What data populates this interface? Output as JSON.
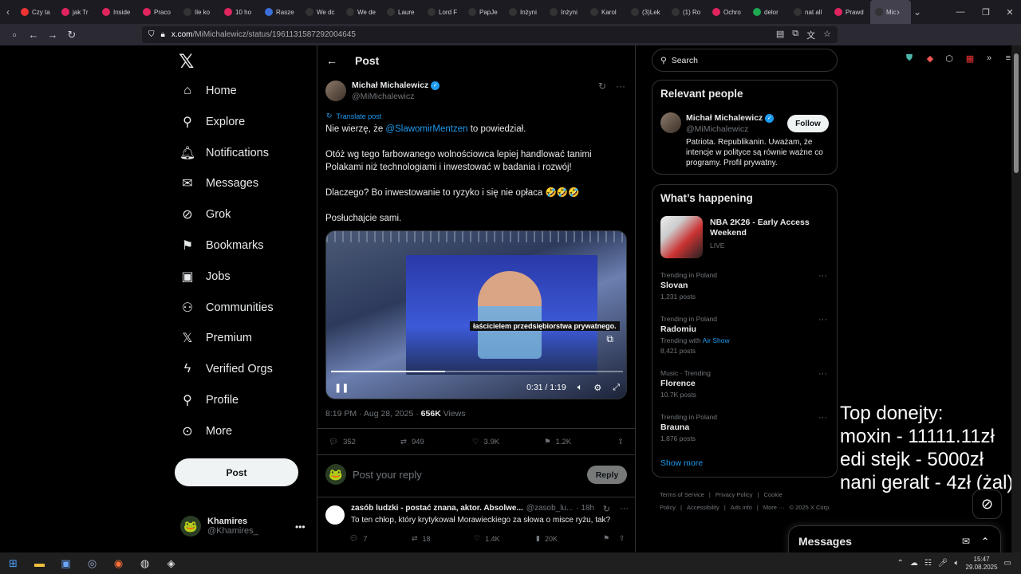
{
  "browser": {
    "tabs": [
      {
        "label": "Czy ta",
        "color": "#e33"
      },
      {
        "label": "jak Tr",
        "color": "#e0245e"
      },
      {
        "label": "Inside",
        "color": "#e0245e"
      },
      {
        "label": "Praco",
        "color": "#e0245e"
      },
      {
        "label": "Ile ko",
        "color": "#333"
      },
      {
        "label": "10 ho",
        "color": "#e0245e"
      },
      {
        "label": "Rasze",
        "color": "#3b6fd8"
      },
      {
        "label": "We dc",
        "color": "#333"
      },
      {
        "label": "We de",
        "color": "#333"
      },
      {
        "label": "Laure",
        "color": "#333"
      },
      {
        "label": "Lord F",
        "color": "#333"
      },
      {
        "label": "PapJe",
        "color": "#333"
      },
      {
        "label": "Inżyni",
        "color": "#333"
      },
      {
        "label": "Inżyni",
        "color": "#333"
      },
      {
        "label": "Karol",
        "color": "#333"
      },
      {
        "label": "(3)Lek",
        "color": "#333"
      },
      {
        "label": "(1) Ro",
        "color": "#333"
      },
      {
        "label": "Ochro",
        "color": "#e0245e"
      },
      {
        "label": "delor",
        "color": "#1da851"
      },
      {
        "label": "nat all",
        "color": "#333"
      },
      {
        "label": "Prawd",
        "color": "#e0245e"
      },
      {
        "label": "Mic",
        "color": "#333",
        "active": true
      }
    ],
    "url_host": "x.com",
    "url_path": "/MiMichalewicz/status/1961131587292004645"
  },
  "sidebar": {
    "logo": "𝕏",
    "items": [
      {
        "label": "Home",
        "icon": "home-icon",
        "glyph": "⌂"
      },
      {
        "label": "Explore",
        "icon": "search-icon",
        "glyph": "⚲"
      },
      {
        "label": "Notifications",
        "icon": "bell-icon",
        "glyph": "🔔︎"
      },
      {
        "label": "Messages",
        "icon": "envelope-icon",
        "glyph": "✉"
      },
      {
        "label": "Grok",
        "icon": "grok-icon",
        "glyph": "⊘"
      },
      {
        "label": "Bookmarks",
        "icon": "bookmark-icon",
        "glyph": "⚑"
      },
      {
        "label": "Jobs",
        "icon": "briefcase-icon",
        "glyph": "▣"
      },
      {
        "label": "Communities",
        "icon": "people-icon",
        "glyph": "⚇"
      },
      {
        "label": "Premium",
        "icon": "x-logo-icon",
        "glyph": "𝕏"
      },
      {
        "label": "Verified Orgs",
        "icon": "lightning-icon",
        "glyph": "ϟ"
      },
      {
        "label": "Profile",
        "icon": "person-icon",
        "glyph": "⚲"
      },
      {
        "label": "More",
        "icon": "more-circle-icon",
        "glyph": "⊙"
      }
    ],
    "post_label": "Post",
    "account": {
      "name": "Khamires",
      "handle": "@Khamires_"
    }
  },
  "post": {
    "header_title": "Post",
    "author_name": "Michał Michalewicz",
    "author_handle": "@MiMichalewicz",
    "translate_label": "Translate post",
    "text_p1_before": "Nie wierzę, że ",
    "text_p1_mention": "@SlawomirMentzen",
    "text_p1_after": " to powiedział.",
    "text_p2": "Otóż wg tego farbowanego wolnościowca lepiej handlować tanimi Polakami niż technologiami i inwestować w badania i rozwój!",
    "text_p3": "Dlaczego? Bo inwestowanie to ryzyko i się nie opłaca 🤣🤣🤣",
    "text_p4": "Posłuchajcie sami.",
    "video": {
      "caption": "łaścicielem przedsiębiorstwa prywatnego.",
      "time": "0:31 / 1:19",
      "progress": 0.39
    },
    "timestamp": "8:19 PM · Aug 28, 2025 · ",
    "views_count": "656K",
    "views_label": " Views",
    "stats": {
      "replies": "352",
      "reposts": "949",
      "likes": "3.9K",
      "bookmarks": "1.2K"
    },
    "reply_placeholder": "Post your reply",
    "reply_button": "Reply"
  },
  "reply": {
    "name": "zasób ludzki - postać znana, aktor. Absolwe...",
    "handle": "@zasob_lu...",
    "time": "· 18h",
    "text": "To ten chłop, który krytykował Morawieckiego za słowa o misce ryżu, tak?",
    "stats": {
      "replies": "7",
      "reposts": "18",
      "likes": "1.4K",
      "views": "20K"
    }
  },
  "right": {
    "search_placeholder": "Search",
    "relevant_title": "Relevant people",
    "person": {
      "name": "Michał Michalewicz",
      "handle": "@MiMichalewicz",
      "follow": "Follow",
      "bio": "Patriota. Republikanin. Uważam, że intencje w polityce są równie ważne co programy. Profil prywatny."
    },
    "happening_title": "What’s happening",
    "nba": {
      "title": "NBA 2K26 - Early Access Weekend",
      "status": "LIVE"
    },
    "trends": [
      {
        "category": "Trending in Poland",
        "title": "Slovan",
        "sub": "1,231 posts"
      },
      {
        "category": "Trending in Poland",
        "title": "Radomiu",
        "sub_prefix": "Trending with ",
        "sub_link": "Air Show",
        "sub2": "8,421 posts"
      },
      {
        "category": "Music · Trending",
        "title": "Florence",
        "sub": "10.7K posts"
      },
      {
        "category": "Trending in Poland",
        "title": "Brauna",
        "sub": "1,876 posts"
      }
    ],
    "show_more": "Show more",
    "footer": [
      "Terms of Service",
      "|",
      "Privacy Policy",
      "|",
      "Cookie Policy",
      "|",
      "Accessibility",
      "|",
      "Ads info",
      "|",
      "More ···",
      "© 2025 X Corp."
    ]
  },
  "overlay": {
    "line1": "Top donejty:",
    "line2": "moxin - 11111.11zł",
    "line3": "edi stejk - 5000zł",
    "line4": "nani geralt - 4zł (żal)"
  },
  "messages_drawer": {
    "title": "Messages"
  },
  "taskbar": {
    "time": "15:47",
    "date": "29.08.2025"
  }
}
